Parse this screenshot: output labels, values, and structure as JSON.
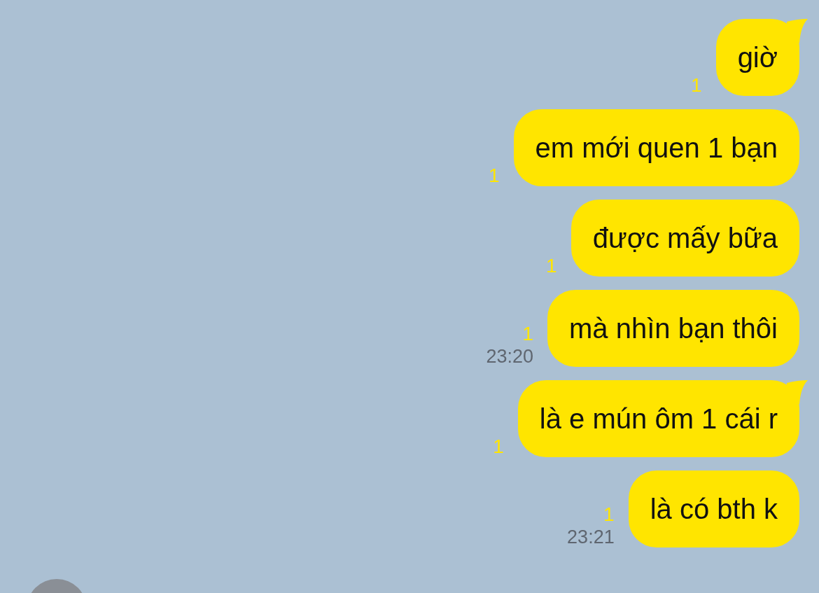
{
  "messages": [
    {
      "text": "giờ",
      "unread": "1",
      "tail": true
    },
    {
      "text": "em mới quen 1 bạn",
      "unread": "1",
      "tail": false
    },
    {
      "text": "được mấy bữa",
      "unread": "1",
      "tail": false
    },
    {
      "text": "mà nhìn bạn thôi",
      "unread": "1",
      "time": "23:20",
      "tail": false
    },
    {
      "text": "là e mún ôm 1 cái r",
      "unread": "1",
      "tail": true
    },
    {
      "text": "là có bth k",
      "unread": "1",
      "time": "23:21",
      "tail": false
    }
  ]
}
